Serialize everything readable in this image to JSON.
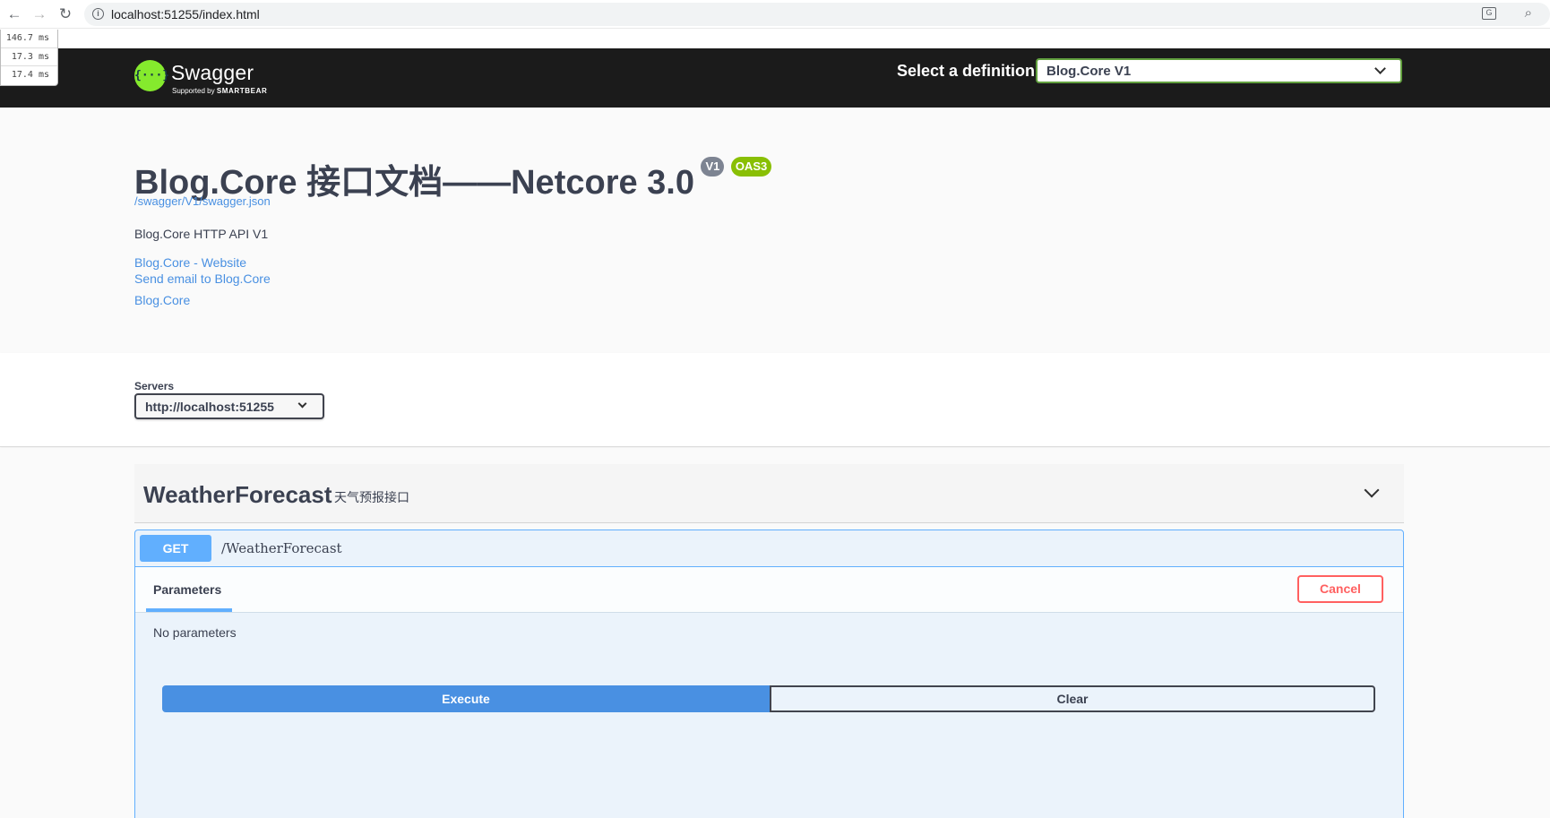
{
  "browser": {
    "url": "localhost:51255/index.html",
    "back_icon": "←",
    "forward_icon": "→",
    "reload_icon": "↻"
  },
  "timings": [
    "146.7 ms",
    "17.3 ms",
    "17.4 ms"
  ],
  "topbar": {
    "logo_glyph": "{···}",
    "logo_text": "Swagger",
    "logo_sub_prefix": "Supported by",
    "logo_sub_brand": "SMARTBEAR",
    "select_label": "Select a definition",
    "definition_selected": "Blog.Core V1"
  },
  "info": {
    "title": "Blog.Core 接口文档——Netcore 3.0",
    "version_badge": "V1",
    "oas_badge": "OAS3",
    "spec_url": "/swagger/V1/swagger.json",
    "description": "Blog.Core HTTP API V1",
    "website_link": "Blog.Core - Website",
    "email_link": "Send email to Blog.Core",
    "license_link": "Blog.Core"
  },
  "servers": {
    "label": "Servers",
    "selected": "http://localhost:51255"
  },
  "tag": {
    "name": "WeatherForecast",
    "description": "天气预报接口"
  },
  "operation": {
    "method": "GET",
    "path": "/WeatherForecast",
    "params_tab": "Parameters",
    "cancel_label": "Cancel",
    "no_params": "No parameters",
    "execute_label": "Execute",
    "clear_label": "Clear"
  },
  "colors": {
    "topbar_bg": "#1b1b1b",
    "logo_green": "#85ea2d",
    "get_blue": "#61affe",
    "link_blue": "#4990e2",
    "badge_gray": "#7d8492",
    "badge_green": "#89bf04",
    "cancel_red": "#ff6060"
  }
}
